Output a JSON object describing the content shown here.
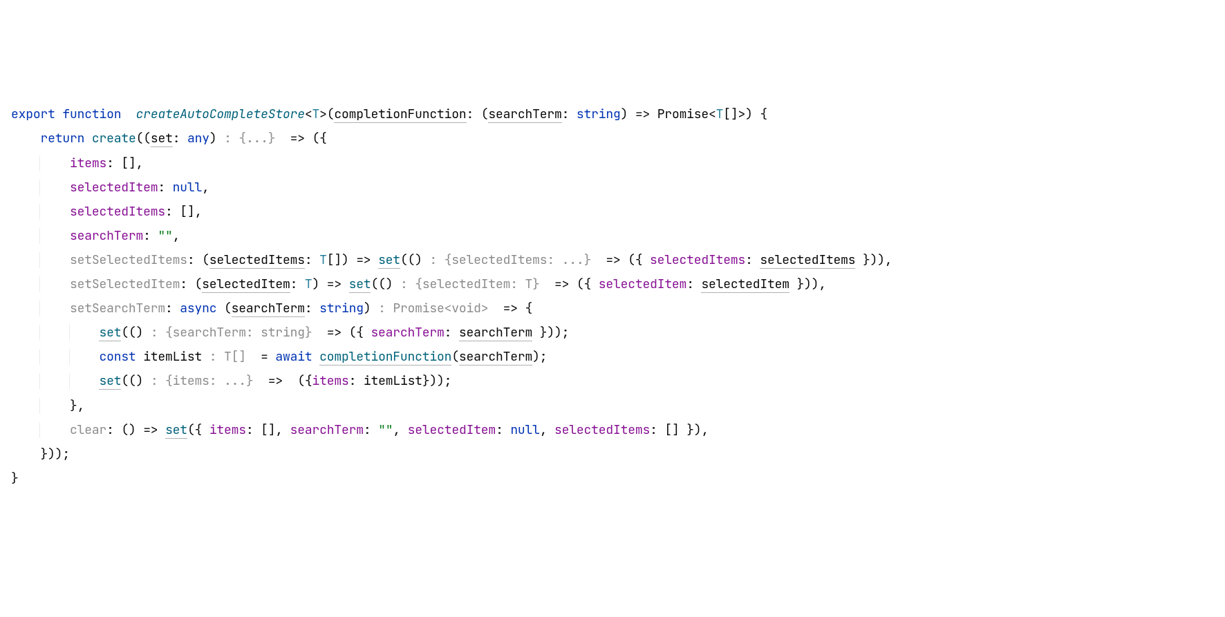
{
  "code": {
    "kw_export": "export",
    "kw_function": "function",
    "fn_name": "createAutoCompleteStore",
    "generic_T": "T",
    "param_completionFunction": "completionFunction",
    "param_searchTerm": "searchTerm",
    "type_string": "string",
    "type_Promise": "Promise",
    "type_any": "any",
    "type_void": "void",
    "kw_return": "return",
    "fn_create": "create",
    "param_set": "set",
    "hint_braces": ": {...}",
    "prop_items": "items",
    "prop_selectedItem": "selectedItem",
    "kw_null": "null",
    "prop_selectedItems": "selectedItems",
    "prop_searchTerm": "searchTerm",
    "str_empty": "\"\"",
    "prop_setSelectedItems": "setSelectedItems",
    "param_selectedItems": "selectedItems",
    "hint_selectedItems": ": {selectedItems: ...}",
    "prop_setSelectedItem": "setSelectedItem",
    "param_selectedItem": "selectedItem",
    "hint_selectedItem": ": {selectedItem: T}",
    "prop_setSearchTerm": "setSearchTerm",
    "kw_async": "async",
    "hint_promise_void": ": Promise<void>",
    "hint_searchTerm_string": ": {searchTerm: string}",
    "kw_const": "const",
    "id_itemList": "itemList",
    "hint_T_arr": ": T[]",
    "kw_await": "await",
    "hint_items": ": {items: ...}",
    "prop_clear": "clear",
    "arrow": "=>",
    "id_searchTerm": "searchTerm",
    "id_selectedItems": "selectedItems",
    "id_selectedItem": "selectedItem"
  }
}
